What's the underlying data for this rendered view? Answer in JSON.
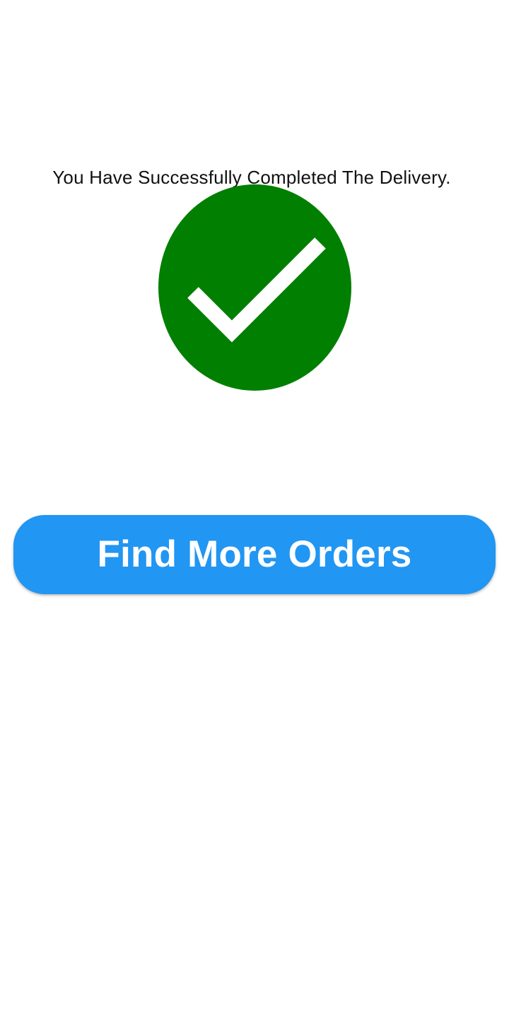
{
  "screen": {
    "message": "You Have Successfully Completed The Delivery.",
    "success_icon": "checkmark-circle-icon",
    "primary_action_label": "Find More Orders"
  },
  "colors": {
    "background": "#FFFFFF",
    "success": "#007F00",
    "check": "#FFFFFF",
    "button": "#2196F3",
    "button_text": "#FFFFFF",
    "text": "#111111"
  }
}
